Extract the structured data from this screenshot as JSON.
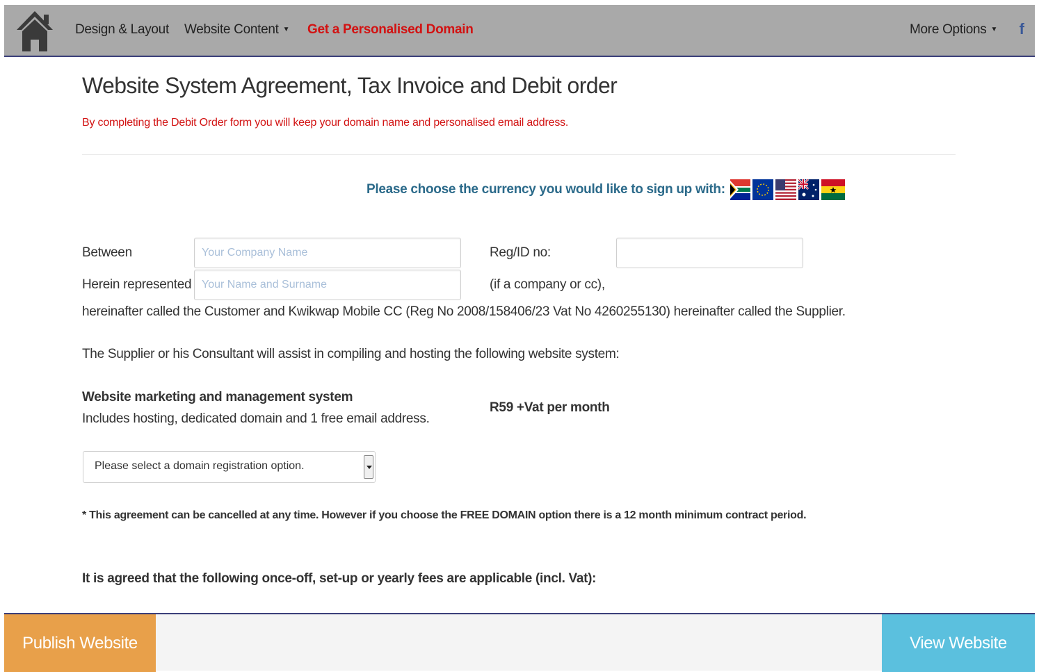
{
  "nav": {
    "home_icon": "home-icon",
    "items": [
      {
        "label": "Design & Layout"
      },
      {
        "label": "Website Content"
      },
      {
        "label": "Get a Personalised Domain"
      }
    ],
    "more_options": "More Options",
    "facebook_icon": "f"
  },
  "main": {
    "title": "Website System Agreement, Tax Invoice and Debit order",
    "subtitle": "By completing the Debit Order form you will keep your domain name and personalised email address.",
    "currency_prompt": "Please choose the currency you would like to sign up with:",
    "currency_flags": [
      "south-africa-flag",
      "eu-flag",
      "usa-flag",
      "australia-flag",
      "ghana-flag"
    ],
    "form": {
      "between_label": "Between",
      "company_placeholder": "Your Company Name",
      "regid_label": "Reg/ID no:",
      "regid_value": "",
      "represented_label": "Herein represented by:",
      "name_placeholder": "Your Name and Surname",
      "company_note": "(if a company or cc),"
    },
    "hereinafter_text": "hereinafter called the Customer and Kwikwap Mobile CC (Reg No 2008/158406/23 Vat No 4260255130) hereinafter called the Supplier.",
    "supplier_text": "The Supplier or his Consultant will assist in compiling and hosting the following website system:",
    "system_title": "Website marketing and management system",
    "system_desc": "Includes hosting, dedicated domain and 1 free email address.",
    "price": "R59 +Vat per month",
    "domain_select": "Please select a domain registration option.",
    "note": "* This agreement can be cancelled at any time. However if you choose the FREE DOMAIN option there is a 12 month minimum contract period.",
    "fees_heading": "It is agreed that the following once-off, set-up or yearly fees are applicable (incl. Vat):"
  },
  "footer": {
    "publish_label": "Publish Website",
    "view_label": "View Website"
  },
  "colors": {
    "nav_bg": "#a9a9a9",
    "accent_red": "#d21212",
    "currency_blue": "#2b6a8a",
    "publish_orange": "#e8a04a",
    "view_blue": "#5bc0de"
  }
}
